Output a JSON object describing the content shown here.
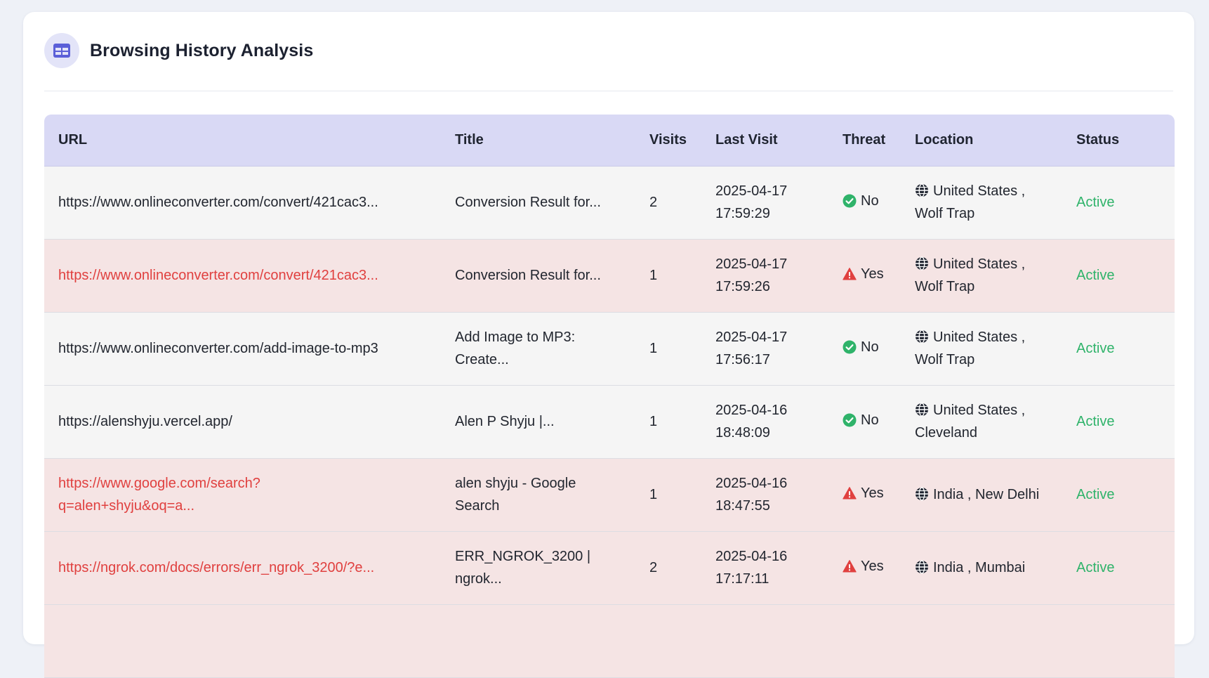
{
  "page": {
    "title": "Browsing History Analysis",
    "icon": "table-icon"
  },
  "colors": {
    "accent": "#5b5fd8",
    "header_bg": "#d9d9f5",
    "threat_row": "#f5e4e4",
    "safe_row": "#f5f5f5",
    "danger": "#e0403f",
    "ok": "#2fb36a"
  },
  "table": {
    "columns": [
      "URL",
      "Title",
      "Visits",
      "Last Visit",
      "Threat",
      "Location",
      "Status"
    ],
    "rows": [
      {
        "url": "https://www.onlineconverter.com/convert/421cac3...",
        "title": "Conversion Result for...",
        "visits": "2",
        "date": "2025-04-17",
        "time": "17:59:29",
        "threat": "No",
        "threat_icon": "check-circle-icon",
        "location": "United States , Wolf Trap",
        "location_line1": "United States ,",
        "location_line2": "Wolf Trap",
        "location_icon": "globe-icon",
        "status": "Active"
      },
      {
        "url": "https://www.onlineconverter.com/convert/421cac3...",
        "title": "Conversion Result for...",
        "visits": "1",
        "date": "2025-04-17",
        "time": "17:59:26",
        "threat": "Yes",
        "threat_icon": "warning-icon",
        "location": "United States , Wolf Trap",
        "location_line1": "United States ,",
        "location_line2": "Wolf Trap",
        "location_icon": "globe-icon",
        "status": "Active"
      },
      {
        "url": "https://www.onlineconverter.com/add-image-to-mp3",
        "title": "Add Image to MP3: Create...",
        "title_line1": "Add Image to MP3:",
        "title_line2": "Create...",
        "visits": "1",
        "date": "2025-04-17",
        "time": "17:56:17",
        "threat": "No",
        "threat_icon": "check-circle-icon",
        "location": "United States , Wolf Trap",
        "location_line1": "United States ,",
        "location_line2": "Wolf Trap",
        "location_icon": "globe-icon",
        "status": "Active"
      },
      {
        "url": "https://alenshyju.vercel.app/",
        "title": "Alen P Shyju |...",
        "visits": "1",
        "date": "2025-04-16",
        "time": "18:48:09",
        "threat": "No",
        "threat_icon": "check-circle-icon",
        "location": "United States , Cleveland",
        "location_line1": "United States ,",
        "location_line2": "Cleveland",
        "location_icon": "globe-icon",
        "status": "Active"
      },
      {
        "url": "https://www.google.com/search?q=alen+shyju&oq=a...",
        "url_line1": "https://www.google.com/search?",
        "url_line2": "q=alen+shyju&oq=a...",
        "title": "alen shyju - Google Search",
        "title_line1": "alen shyju - Google",
        "title_line2": "Search",
        "visits": "1",
        "date": "2025-04-16",
        "time": "18:47:55",
        "threat": "Yes",
        "threat_icon": "warning-icon",
        "location": "India , New Delhi",
        "location_icon": "globe-icon",
        "status": "Active"
      },
      {
        "url": "https://ngrok.com/docs/errors/err_ngrok_3200/?e...",
        "title": "ERR_NGROK_3200 | ngrok...",
        "title_line1": "ERR_NGROK_3200 |",
        "title_line2": "ngrok...",
        "visits": "2",
        "date": "2025-04-16",
        "time": "17:17:11",
        "threat": "Yes",
        "threat_icon": "warning-icon",
        "location": "India , Mumbai",
        "location_icon": "globe-icon",
        "status": "Active"
      }
    ]
  }
}
